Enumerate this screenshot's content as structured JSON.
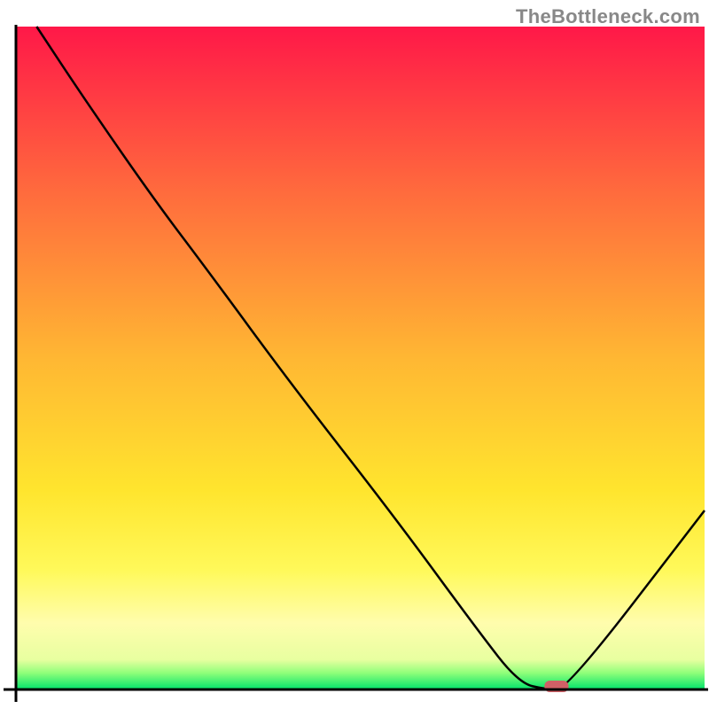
{
  "watermark": {
    "text": "TheBottleneck.com"
  },
  "chart_data": {
    "type": "line",
    "title": "",
    "xlabel": "",
    "ylabel": "",
    "xlim": [
      0,
      100
    ],
    "ylim": [
      0,
      100
    ],
    "x": [
      3,
      10,
      20,
      28,
      40,
      55,
      67,
      73,
      77,
      80,
      100
    ],
    "series": [
      {
        "name": "curve",
        "values": [
          100,
          89,
          74,
          63,
          46,
          26,
          9,
          1,
          0,
          0,
          27
        ]
      }
    ],
    "marker": {
      "x_center": 78.5,
      "y": 0,
      "width": 3.5
    },
    "gradient_stops": [
      {
        "offset": 0.0,
        "color": "#ff1848"
      },
      {
        "offset": 0.25,
        "color": "#ff6b3d"
      },
      {
        "offset": 0.5,
        "color": "#ffb733"
      },
      {
        "offset": 0.7,
        "color": "#ffe52e"
      },
      {
        "offset": 0.82,
        "color": "#fff95a"
      },
      {
        "offset": 0.9,
        "color": "#fffdad"
      },
      {
        "offset": 0.955,
        "color": "#e8ffa0"
      },
      {
        "offset": 0.975,
        "color": "#8fff7a"
      },
      {
        "offset": 1.0,
        "color": "#00e26b"
      }
    ],
    "axis_color": "#000000"
  }
}
